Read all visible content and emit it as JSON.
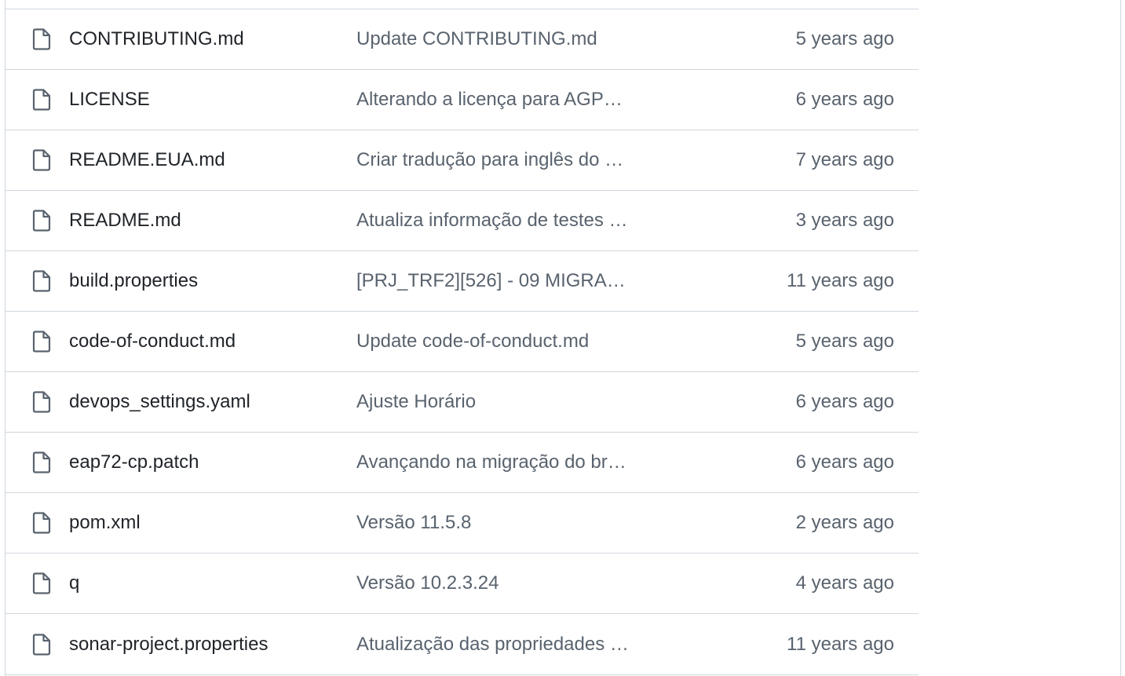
{
  "colors": {
    "border": "#d0d7de",
    "file_name": "#1f2328",
    "muted_text": "#59636e",
    "icon": "#59636e"
  },
  "files": [
    {
      "icon": "file-icon",
      "name": "CONTRIBUTING.md",
      "message": "Update CONTRIBUTING.md",
      "age": "5 years ago"
    },
    {
      "icon": "file-icon",
      "name": "LICENSE",
      "message": "Alterando a licença para AGP…",
      "age": "6 years ago"
    },
    {
      "icon": "file-icon",
      "name": "README.EUA.md",
      "message": "Criar tradução para inglês do …",
      "age": "7 years ago"
    },
    {
      "icon": "file-icon",
      "name": "README.md",
      "message": "Atualiza informação de testes …",
      "age": "3 years ago"
    },
    {
      "icon": "file-icon",
      "name": "build.properties",
      "message": "[PRJ_TRF2][526] - 09 MIGRA…",
      "age": "11 years ago"
    },
    {
      "icon": "file-icon",
      "name": "code-of-conduct.md",
      "message": "Update code-of-conduct.md",
      "age": "5 years ago"
    },
    {
      "icon": "file-icon",
      "name": "devops_settings.yaml",
      "message": "Ajuste Horário",
      "age": "6 years ago"
    },
    {
      "icon": "file-icon",
      "name": "eap72-cp.patch",
      "message": "Avançando na migração do br…",
      "age": "6 years ago"
    },
    {
      "icon": "file-icon",
      "name": "pom.xml",
      "message": "Versão 11.5.8",
      "age": "2 years ago"
    },
    {
      "icon": "file-icon",
      "name": "q",
      "message": "Versão 10.2.3.24",
      "age": "4 years ago"
    },
    {
      "icon": "file-icon",
      "name": "sonar-project.properties",
      "message": "Atualização das propriedades …",
      "age": "11 years ago"
    }
  ]
}
